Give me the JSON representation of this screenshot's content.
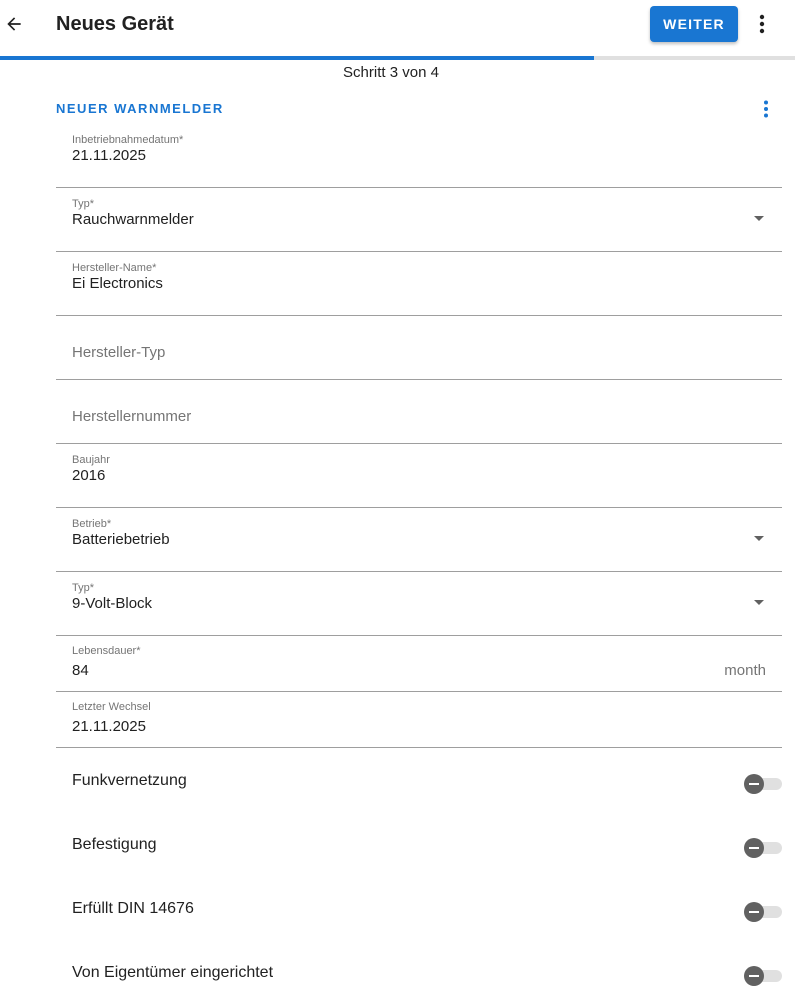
{
  "header": {
    "title": "Neues Gerät",
    "primary_button": "WEITER",
    "back_icon": "arrow-left-icon",
    "menu_icon": "more-vertical-icon"
  },
  "progress": {
    "fraction": 0.747,
    "label": "Schritt 3 von 4"
  },
  "section": {
    "title": "NEUER WARNMELDER",
    "menu_icon": "more-vertical-icon"
  },
  "fields": {
    "commissioning_date": {
      "label": "Inbetriebnahmedatum*",
      "value": "21.11.2025"
    },
    "type": {
      "label": "Typ*",
      "value": "Rauchwarnmelder"
    },
    "manufacturer_name": {
      "label": "Hersteller-Name*",
      "value": "Ei Electronics"
    },
    "manufacturer_type": {
      "placeholder": "Hersteller-Typ"
    },
    "manufacturer_number": {
      "placeholder": "Herstellernummer"
    },
    "year": {
      "label": "Baujahr",
      "value": "2016"
    },
    "operation": {
      "label": "Betrieb*",
      "value": "Batteriebetrieb"
    },
    "battery_type": {
      "label": "Typ*",
      "value": "9-Volt-Block"
    },
    "lifetime": {
      "label": "Lebensdauer*",
      "value": "84",
      "suffix": "month"
    },
    "last_change": {
      "label": "Letzter Wechsel",
      "value": "21.11.2025"
    }
  },
  "toggles": {
    "radio_networking": {
      "label": "Funkvernetzung",
      "checked": false
    },
    "mounting": {
      "label": "Befestigung",
      "checked": false
    },
    "din": {
      "label": "Erfüllt DIN 14676",
      "checked": false
    },
    "owner_installed": {
      "label": "Von Eigentümer eingerichtet",
      "checked": false
    }
  },
  "colors": {
    "accent": "#1976d2",
    "text": "#212121",
    "muted": "#757575",
    "divider": "#9e9e9e"
  }
}
